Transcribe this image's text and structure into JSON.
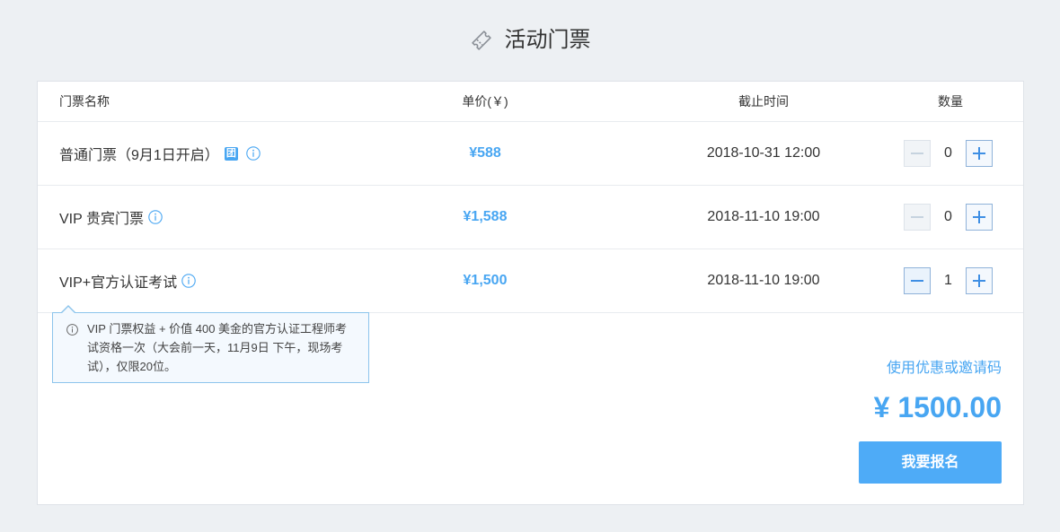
{
  "page": {
    "title": "活动门票",
    "title_icon": "ticket-icon"
  },
  "table": {
    "columns": [
      "门票名称",
      "单价(￥)",
      "截止时间",
      "数量"
    ],
    "rows": [
      {
        "name": "普通门票（9月1日开启）",
        "badge": "团",
        "info_icon": "info-icon",
        "price": "¥588",
        "deadline": "2018-10-31 12:00",
        "quantity": 0,
        "minus_disabled": true
      },
      {
        "name": "VIP 贵宾门票",
        "info_icon": "info-icon",
        "price": "¥1,588",
        "deadline": "2018-11-10 19:00",
        "quantity": 0,
        "minus_disabled": true
      },
      {
        "name": "VIP+官方认证考试",
        "info_icon": "info-icon",
        "price": "¥1,500",
        "deadline": "2018-11-10 19:00",
        "quantity": 1,
        "minus_disabled": false
      }
    ]
  },
  "tooltip": {
    "icon": "info-icon",
    "text": "VIP 门票权益 + 价值 400 美金的官方认证工程师考试资格一次（大会前一天，11月9日 下午，现场考试），仅限20位。"
  },
  "summary": {
    "coupon_link": "使用优惠或邀请码",
    "total": "¥ 1500.00",
    "submit_label": "我要报名"
  },
  "colors": {
    "accent": "#48a6f2",
    "button": "#4eabf7",
    "text": "#333333",
    "page_bg": "#edf0f3",
    "tooltip_border": "#8cc4ec"
  }
}
